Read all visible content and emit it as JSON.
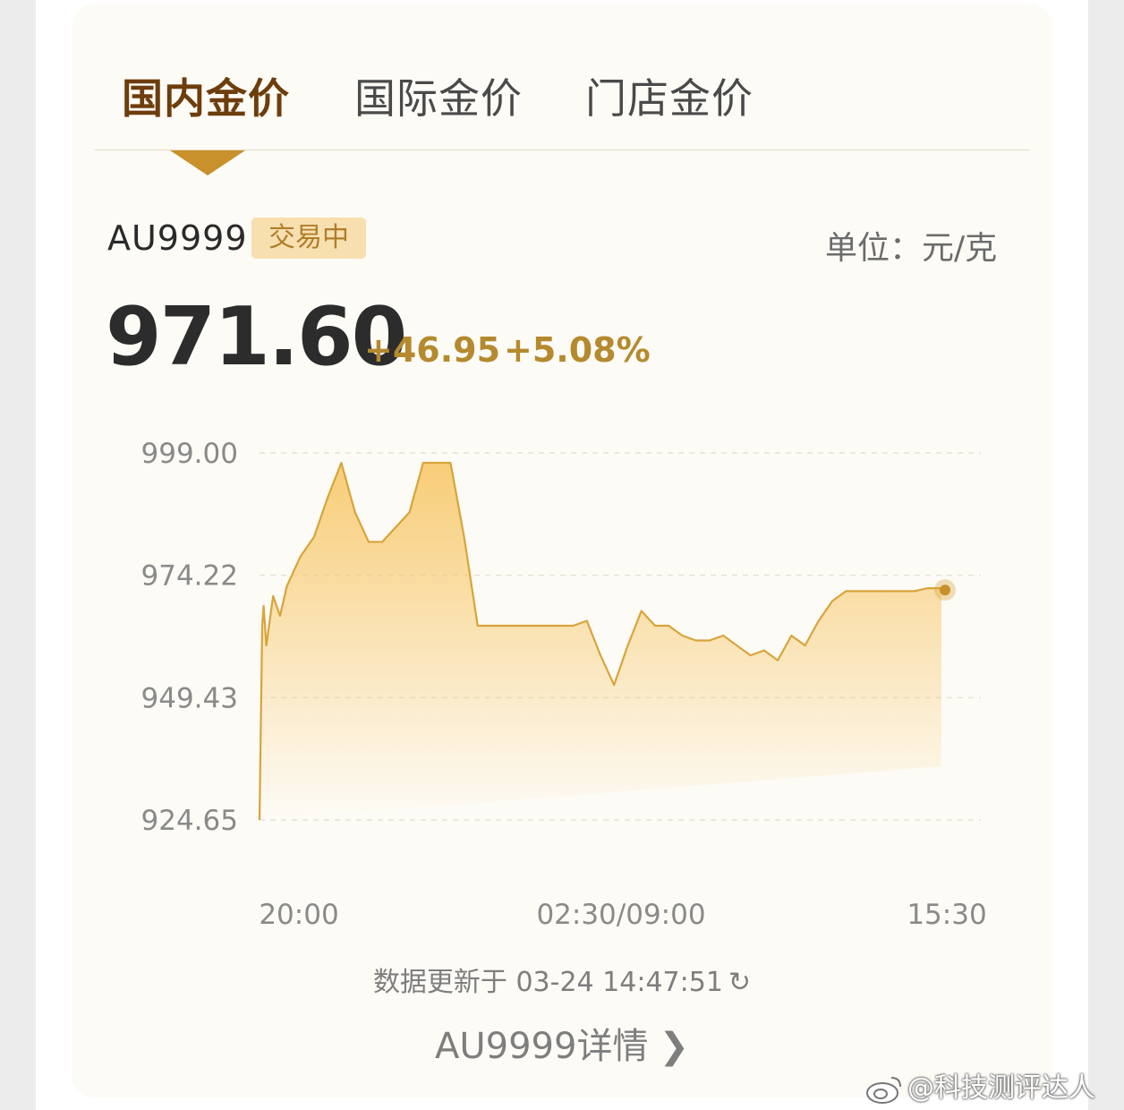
{
  "tabs": [
    {
      "label": "国内金价",
      "active": true
    },
    {
      "label": "国际金价",
      "active": false
    },
    {
      "label": "门店金价",
      "active": false
    }
  ],
  "quote": {
    "code": "AU9999",
    "status": "交易中",
    "unit": "单位：元/克",
    "price": "971.60",
    "change": "+46.95",
    "change_pct": "+5.08%"
  },
  "colors": {
    "accent": "#c8912b",
    "active_tab": "#6d3d0c",
    "change": "#b58a2e",
    "line": "#d8a43a",
    "fill_top": "#f7c86a"
  },
  "chart_data": {
    "type": "area",
    "ylim": [
      924.65,
      999.0
    ],
    "y_ticks": [
      "999.00",
      "974.22",
      "949.43",
      "924.65"
    ],
    "x_ticks": [
      "20:00",
      "02:30/09:00",
      "15:30"
    ],
    "grid": true,
    "last_point_marker": true,
    "series": [
      {
        "x": [
          0,
          0.4,
          0.6,
          1,
          2,
          3,
          4,
          5,
          6,
          8,
          10,
          12,
          14,
          16,
          18,
          20,
          22,
          24,
          26,
          28,
          30,
          32,
          34,
          36,
          38,
          40,
          42,
          44,
          46,
          48,
          50,
          52,
          54,
          56,
          58,
          60,
          62,
          64,
          66,
          68,
          70,
          72,
          74,
          76,
          78,
          80,
          82,
          84,
          86,
          88,
          90,
          92,
          94,
          96,
          98,
          100
        ],
        "values": [
          924.65,
          964,
          968,
          960,
          970,
          966,
          972,
          975,
          978,
          982,
          990,
          997,
          987,
          981,
          981,
          984,
          987,
          997,
          997,
          997,
          982,
          964,
          964,
          964,
          964,
          964,
          964,
          964,
          964,
          965,
          958,
          952,
          960,
          967,
          964,
          964,
          962,
          961,
          961,
          962,
          960,
          958,
          959,
          957,
          962,
          960,
          965,
          969,
          971,
          971,
          971,
          971,
          971,
          971,
          971.6,
          971.6
        ]
      }
    ]
  },
  "footer": {
    "updated": "数据更新于 03-24 14:47:51",
    "refresh_icon": "↻",
    "detail_link": "AU9999详情",
    "chevron": "❯"
  },
  "watermark": {
    "text": "@科技测评达人"
  }
}
